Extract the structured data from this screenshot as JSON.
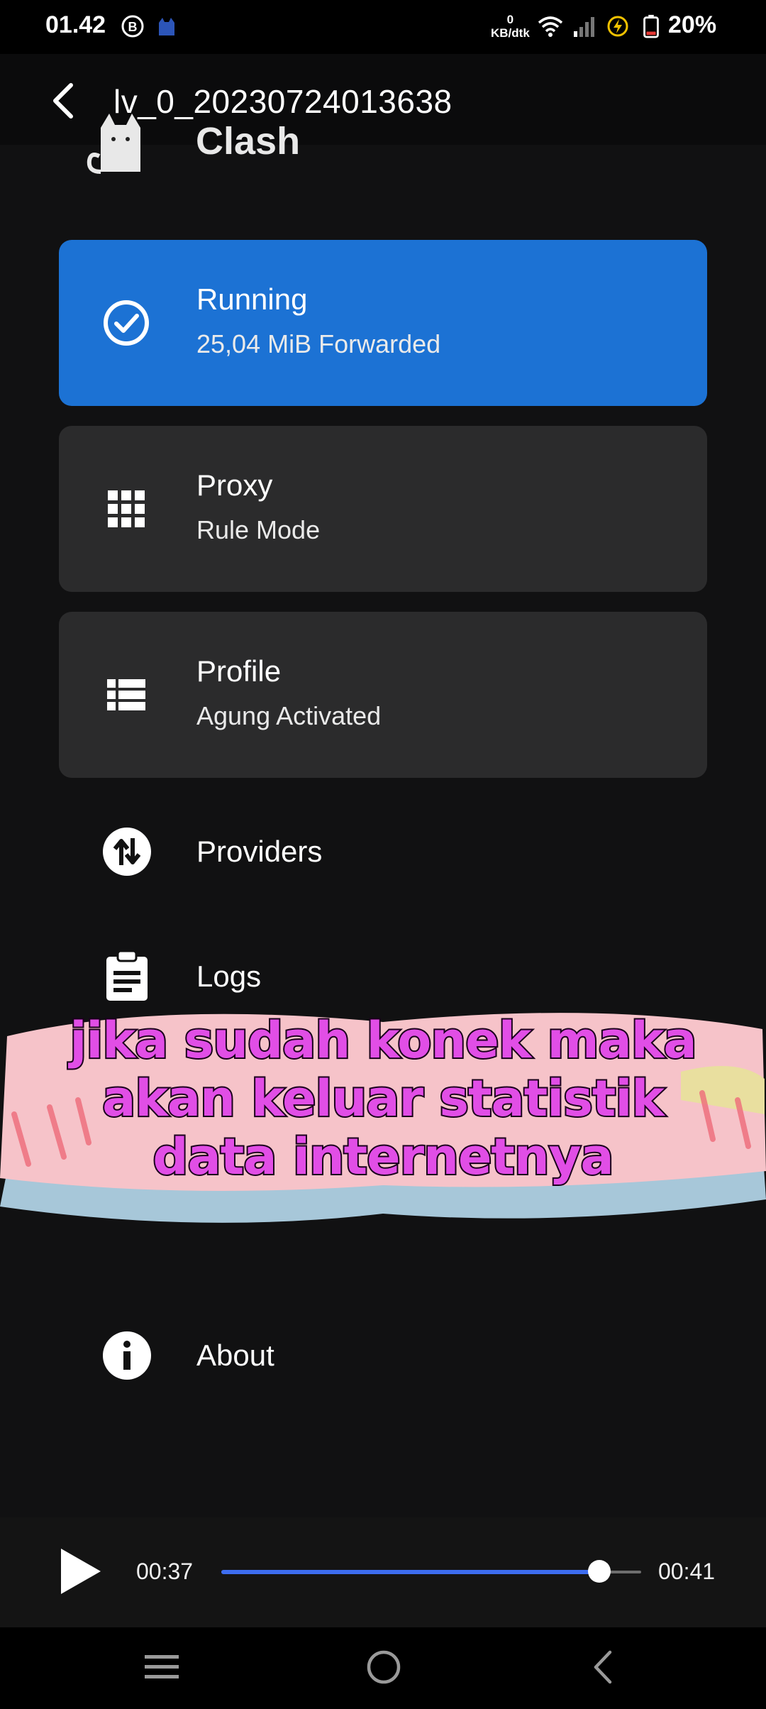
{
  "status_bar": {
    "time": "01.42",
    "net_speed_value": "0",
    "net_speed_unit": "KB/dtk",
    "battery": "20%",
    "icons": [
      "b-icon",
      "cat-icon",
      "wifi-icon",
      "signal-icon",
      "charging-icon",
      "battery-icon"
    ]
  },
  "video": {
    "title": "lv_0_20230724013638",
    "current_time": "00:37",
    "total_time": "00:41",
    "progress_fraction": 0.9
  },
  "app": {
    "name": "Clash",
    "cards": [
      {
        "icon": "check-circle-icon",
        "title": "Running",
        "subtitle": "25,04 MiB Forwarded"
      },
      {
        "icon": "grid-icon",
        "title": "Proxy",
        "subtitle": "Rule Mode"
      },
      {
        "icon": "list-icon",
        "title": "Profile",
        "subtitle": "Agung Activated"
      }
    ],
    "menu": [
      {
        "icon": "providers-icon",
        "label": "Providers"
      },
      {
        "icon": "clipboard-icon",
        "label": "Logs"
      },
      {
        "icon": "info-icon",
        "label": "About"
      }
    ]
  },
  "caption": {
    "lines": [
      "jika sudah konek maka",
      "akan keluar statistik",
      "data internetnya"
    ]
  },
  "colors": {
    "primary_card": "#1c72d4",
    "card": "#2b2b2c",
    "background": "#111112",
    "caption_text": "#e14ee6",
    "seek_fill": "#3d6df0"
  }
}
